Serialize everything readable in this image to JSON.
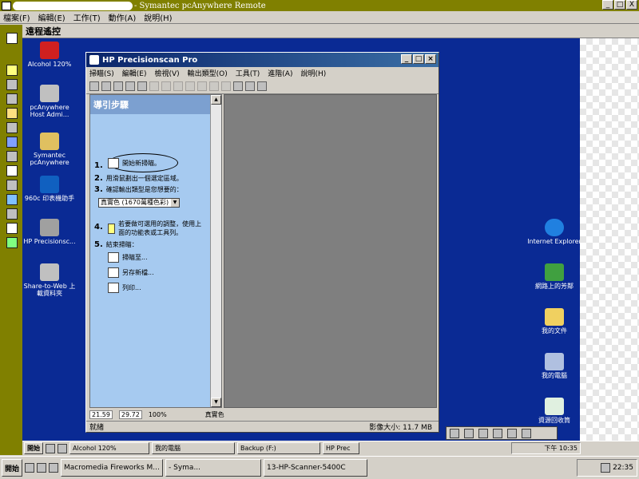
{
  "window": {
    "title": "- Symantec pcAnywhere Remote",
    "buttons": [
      "_",
      "□",
      "X"
    ]
  },
  "menu": [
    "檔案(F)",
    "編輯(E)",
    "工作(T)",
    "動作(A)",
    "說明(H)"
  ],
  "remote_panel_title": "遠程遙控",
  "desktop_icons": [
    {
      "label": "Alcohol 120%",
      "icon": "alcohol-icon"
    },
    {
      "label": "pcAnywhere Host Admi...",
      "icon": "pcanywhere-host-icon"
    },
    {
      "label": "Symantec pcAnywhere",
      "icon": "pcanywhere-icon"
    },
    {
      "label": "960c 印表機助手",
      "icon": "hp-printer-icon"
    },
    {
      "label": "HP Precisionsc...",
      "icon": "hp-scanner-icon"
    },
    {
      "label": "Share-to-Web 上載資料夾",
      "icon": "share-to-web-icon"
    }
  ],
  "right_icons": [
    {
      "label": "Internet Explorer",
      "icon": "ie-icon"
    },
    {
      "label": "網路上的芳鄰",
      "icon": "network-icon"
    },
    {
      "label": "我的文件",
      "icon": "documents-icon"
    },
    {
      "label": "我的電腦",
      "icon": "computer-icon"
    },
    {
      "label": "資源回收筒",
      "icon": "recycle-bin-icon"
    }
  ],
  "hp": {
    "title": "HP Precisionscan Pro",
    "menu": [
      "掃瞄(S)",
      "編輯(E)",
      "檢視(V)",
      "輸出類型(O)",
      "工具(T)",
      "進階(A)",
      "說明(H)"
    ],
    "guide_title": "導引步驟",
    "steps": [
      {
        "n": "1.",
        "text": "開始新掃瞄。"
      },
      {
        "n": "2.",
        "text": "用滑鼠劃出一個選定區域。"
      },
      {
        "n": "3.",
        "text": "確認輸出類型是您想要的："
      },
      {
        "n": "4.",
        "text": "若要做可選用的調整，使用上面的功能表或工具列。"
      },
      {
        "n": "5.",
        "text": "結束掃瞄："
      }
    ],
    "output_type": "真實色 (1670萬種色彩)",
    "finish": [
      "掃瞄至...",
      "另存新檔...",
      "列印..."
    ],
    "status_width": "21.59",
    "status_height": "29.72",
    "status_zoom": "100%",
    "status_mode": "真實色",
    "status_ready": "就緒",
    "status_size": "影像大小: 11.7 MB"
  },
  "remote_taskbar": {
    "start": "開始",
    "items": [
      "Alcohol 120%",
      "我的電腦",
      "Backup (F:)",
      "HP Prec"
    ],
    "clock": "下午 10:35"
  },
  "local_taskbar": {
    "start": "開始",
    "items": [
      "Macromedia Fireworks M...",
      "- Syma...",
      "13-HP-Scanner-5400C"
    ],
    "clock": "22:35"
  }
}
